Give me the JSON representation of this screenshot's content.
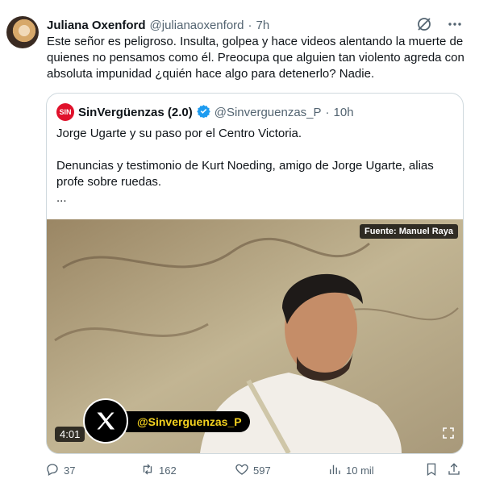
{
  "tweet": {
    "author_name": "Juliana Oxenford",
    "handle": "@julianaoxenford",
    "separator": "·",
    "time": "7h",
    "text": "Este señor es peligroso. Insulta, golpea y hace videos alentando la muerte de quienes no pensamos como él. Preocupa que alguien tan violento agreda con absoluta impunidad ¿quién hace algo para detenerlo? Nadie."
  },
  "quote": {
    "logo_text": "SIN",
    "author_name": "SinVergüenzas (2.0)",
    "handle": "@Sinverguenzas_P",
    "separator": "·",
    "time": "10h",
    "line1": "Jorge Ugarte y su paso por el Centro Victoria.",
    "line2": "Denuncias y testimonio de Kurt Noeding, amigo de Jorge Ugarte, alias profe sobre ruedas.",
    "ellipsis": "...",
    "media": {
      "source_label": "Fuente: Manuel Raya",
      "duration": "4:01",
      "watermark_handle": "@Sinverguenzas_P"
    }
  },
  "actions": {
    "replies": "37",
    "reposts": "162",
    "likes": "597",
    "views": "10 mil"
  },
  "colors": {
    "muted": "#536471",
    "verified": "#1d9bf0",
    "logo_red": "#e0112b",
    "watermark_yellow": "#f4d21f"
  }
}
